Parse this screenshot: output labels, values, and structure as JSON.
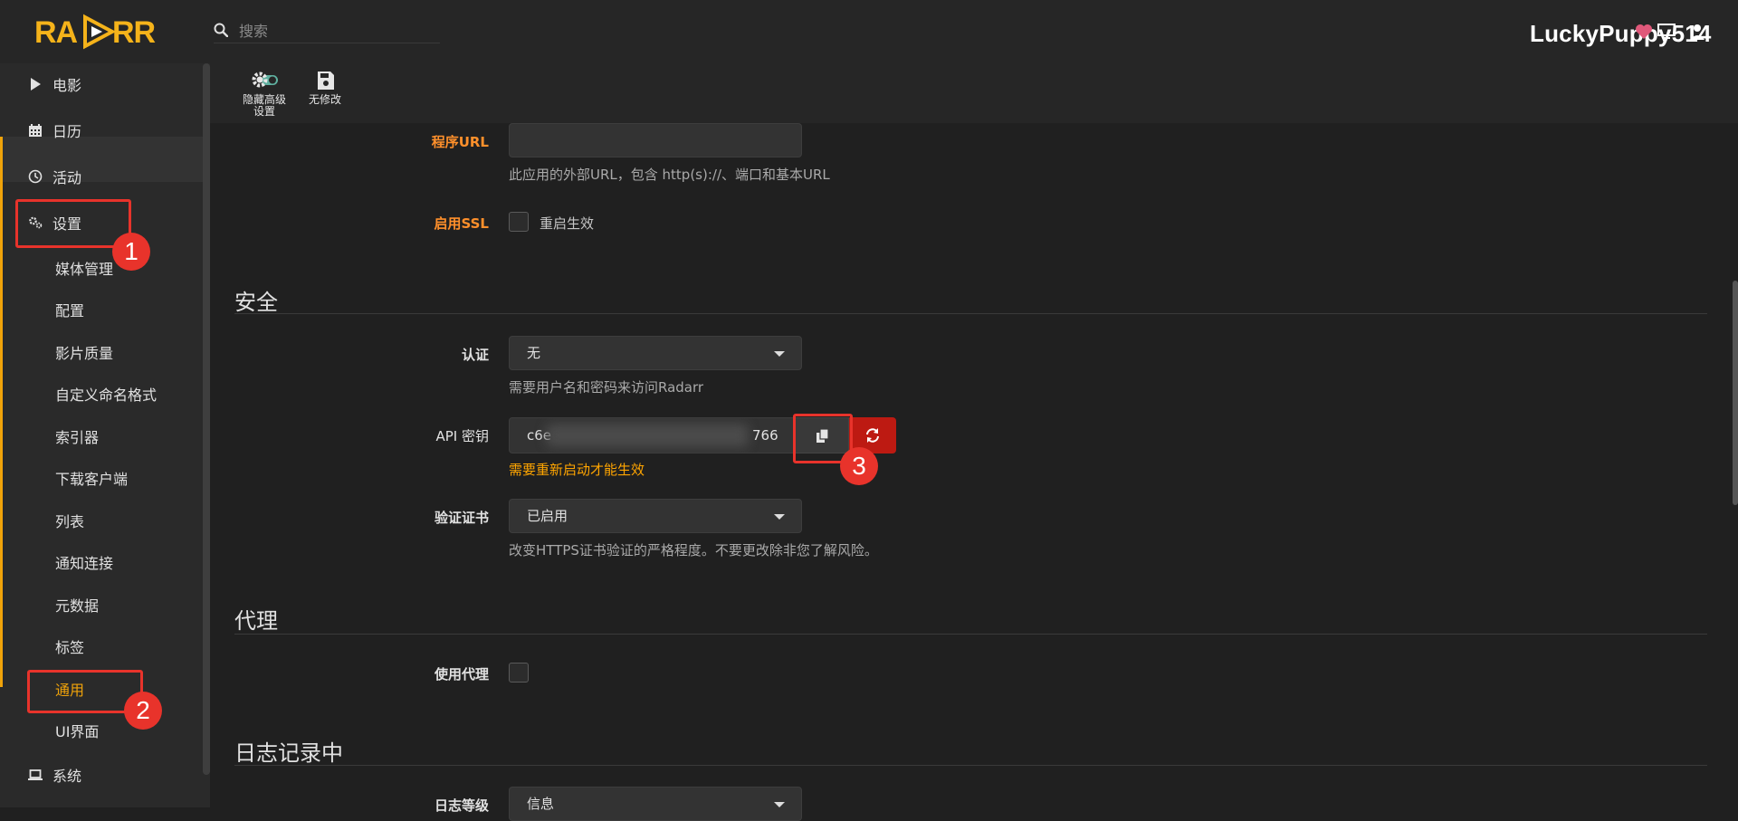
{
  "header": {
    "search_placeholder": "搜索",
    "brand_text": "LuckyPuppy514"
  },
  "sidebar": {
    "items": [
      {
        "label": "电影",
        "icon": "play-icon"
      },
      {
        "label": "日历",
        "icon": "calendar-icon"
      },
      {
        "label": "活动",
        "icon": "clock-icon"
      },
      {
        "label": "设置",
        "icon": "gears-icon"
      },
      {
        "label": "系统",
        "icon": "laptop-icon"
      }
    ],
    "settings_subitems": [
      "媒体管理",
      "配置",
      "影片质量",
      "自定义命名格式",
      "索引器",
      "下载客户端",
      "列表",
      "通知连接",
      "元数据",
      "标签",
      "通用",
      "UI界面"
    ],
    "active_subitem": "通用"
  },
  "toolbar": {
    "hide_advanced_line1": "隐藏高级",
    "hide_advanced_line2": "设置",
    "no_changes": "无修改"
  },
  "form": {
    "app_url": {
      "label": "程序URL",
      "value": "",
      "help": "此应用的外部URL，包含 http(s)://、端口和基本URL"
    },
    "enable_ssl": {
      "label": "启用SSL",
      "checkbox_text": "重启生效",
      "checked": false
    },
    "security": {
      "title": "安全",
      "authentication": {
        "label": "认证",
        "value": "无",
        "help": "需要用户名和密码来访问Radarr"
      },
      "api_key": {
        "label": "API 密钥",
        "prefix": "c6e",
        "suffix": "766",
        "warning": "需要重新启动才能生效"
      },
      "certificate_validation": {
        "label": "验证证书",
        "value": "已启用",
        "help": "改变HTTPS证书验证的严格程度。不要更改除非您了解风险。"
      }
    },
    "proxy": {
      "title": "代理",
      "use_proxy": {
        "label": "使用代理",
        "checked": false
      }
    },
    "logging": {
      "title": "日志记录中",
      "log_level": {
        "label": "日志等级",
        "value": "信息"
      }
    }
  },
  "annotations": [
    "1",
    "2",
    "3"
  ],
  "colors": {
    "accent": "#f0a30a",
    "advanced_label": "#ff902b",
    "warning": "#ffa500",
    "danger": "#bd1a12",
    "annotation": "#e8332b"
  }
}
